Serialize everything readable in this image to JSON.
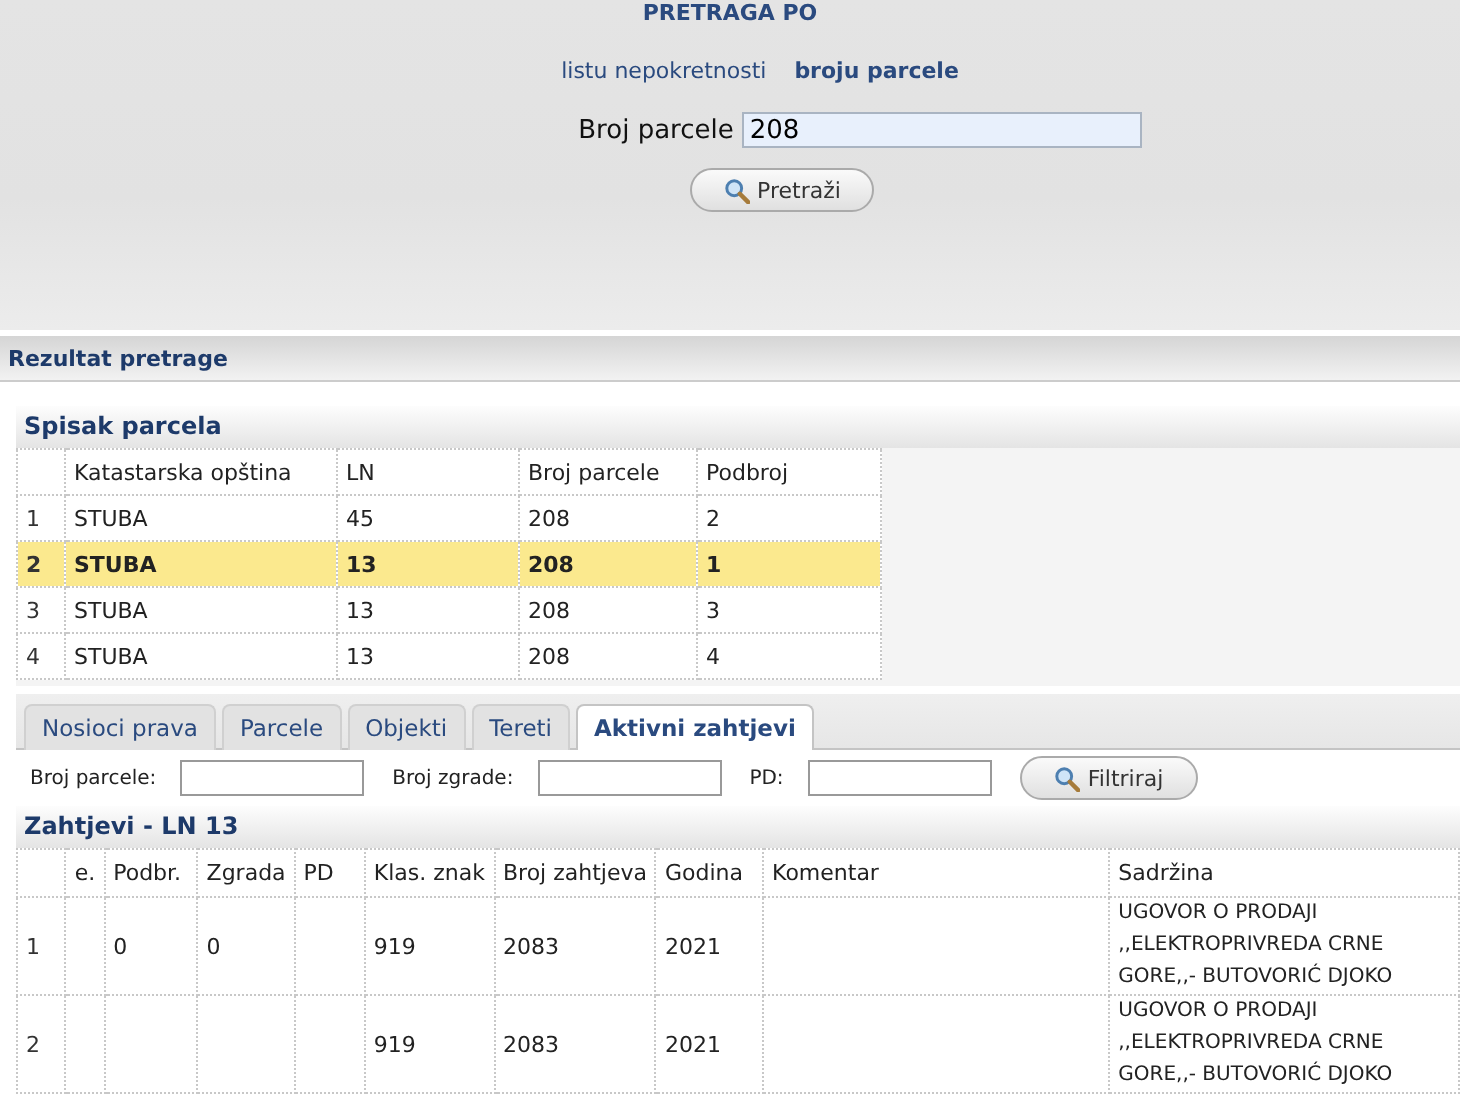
{
  "search_panel": {
    "title": "PRETRAGA PO",
    "modes": [
      {
        "label": "listu nepokretnosti",
        "selected": false
      },
      {
        "label": "broju parcele",
        "selected": true
      }
    ],
    "field": {
      "label": "Broj parcele",
      "value": "208"
    },
    "button": "Pretraži"
  },
  "results_header": "Rezultat pretrage",
  "parcels": {
    "title": "Spisak parcela",
    "columns": [
      "Katastarska opština",
      "LN",
      "Broj parcele",
      "Podbroj"
    ],
    "rows": [
      {
        "index": "1",
        "cells": [
          "STUBA",
          "45",
          "208",
          "2"
        ],
        "selected": false
      },
      {
        "index": "2",
        "cells": [
          "STUBA",
          "13",
          "208",
          "1"
        ],
        "selected": true
      },
      {
        "index": "3",
        "cells": [
          "STUBA",
          "13",
          "208",
          "3"
        ],
        "selected": false
      },
      {
        "index": "4",
        "cells": [
          "STUBA",
          "13",
          "208",
          "4"
        ],
        "selected": false
      }
    ]
  },
  "tabs": [
    {
      "label": "Nosioci prava",
      "selected": false
    },
    {
      "label": "Parcele",
      "selected": false
    },
    {
      "label": "Objekti",
      "selected": false
    },
    {
      "label": "Tereti",
      "selected": false
    },
    {
      "label": "Aktivni zahtjevi",
      "selected": true
    }
  ],
  "filters": [
    {
      "label": "Broj parcele:"
    },
    {
      "label": "Broj zgrade:"
    },
    {
      "label": "PD:"
    }
  ],
  "filter_button": "Filtriraj",
  "requests": {
    "title": "Zahtjevi - LN 13",
    "columns": [
      "e.",
      "Podbr.",
      "Zgrada",
      "PD",
      "Klas. znak",
      "Broj zahtjeva",
      "Godina",
      "Komentar",
      "Sadržina"
    ],
    "rows": [
      {
        "index": "1",
        "cells": [
          "",
          "0",
          "0",
          "",
          "919",
          "2083",
          "2021",
          "",
          "UGOVOR O PRODAJI ,,ELEKTROPRIVREDA CRNE GORE,,- BUTOVORIĆ DJOKO"
        ]
      },
      {
        "index": "2",
        "cells": [
          "",
          "",
          "",
          "",
          "919",
          "2083",
          "2021",
          "",
          "UGOVOR O PRODAJI ,,ELEKTROPRIVREDA CRNE GORE,,- BUTOVORIĆ DJOKO"
        ]
      }
    ]
  }
}
